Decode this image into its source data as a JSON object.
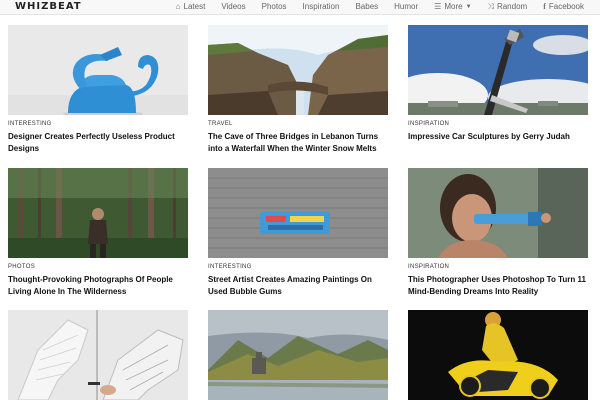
{
  "brand": {
    "logo": "WHIZBEAT"
  },
  "nav": [
    {
      "label": "Latest",
      "icon": "home-icon"
    },
    {
      "label": "Videos",
      "icon": ""
    },
    {
      "label": "Photos",
      "icon": ""
    },
    {
      "label": "Inspiration",
      "icon": ""
    },
    {
      "label": "Babes",
      "icon": ""
    },
    {
      "label": "Humor",
      "icon": ""
    },
    {
      "label": "More",
      "icon": "list-icon"
    },
    {
      "label": "Random",
      "icon": "shuffle-icon"
    },
    {
      "label": "Facebook",
      "icon": "facebook-icon"
    }
  ],
  "articles": [
    {
      "category": "INTERESTING",
      "title": "Designer Creates Perfectly Useless Product Designs",
      "image": "blue watering can with looped spout"
    },
    {
      "category": "TRAVEL",
      "title": "The Cave of Three Bridges in Lebanon Turns into a Waterfall When the Winter Snow Melts",
      "image": "rock gorge with waterfall"
    },
    {
      "category": "INSPIRATION",
      "title": "Impressive Car Sculptures by Gerry Judah",
      "image": "tall car sculpture against cloudy sky"
    },
    {
      "category": "PHOTOS",
      "title": "Thought-Provoking Photographs Of People Living Alone In The Wilderness",
      "image": "man standing in forest"
    },
    {
      "category": "INTERESTING",
      "title": "Street Artist Creates Amazing Paintings On Used Bubble Gums",
      "image": "painted gum on brick pavement"
    },
    {
      "category": "INSPIRATION",
      "title": "This Photographer Uses Photoshop To Turn 11 Mind-Bending Dreams Into Reality",
      "image": "man with clothespin on face"
    },
    {
      "category": "",
      "title": "",
      "image": "paper cut bird wing"
    },
    {
      "category": "",
      "title": "",
      "image": "castle on lake with mountains"
    },
    {
      "category": "",
      "title": "",
      "image": "woman body-painted on yellow motorcycle"
    }
  ]
}
